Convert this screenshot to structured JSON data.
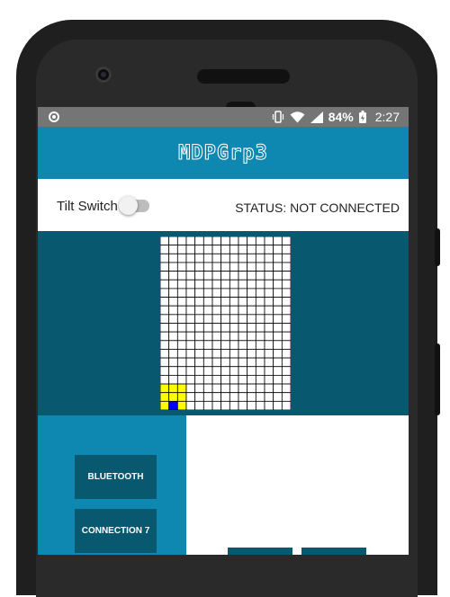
{
  "statusbar": {
    "battery_percent": "84%",
    "time": "2:27",
    "icons": [
      "notification-dot-icon",
      "vibrate-icon",
      "wifi-icon",
      "signal-icon",
      "battery-charging-icon"
    ]
  },
  "appbar": {
    "title": "MDPGrp3"
  },
  "toolbar": {
    "tilt_label": "Tilt Switch",
    "tilt_on": false,
    "status_text": "STATUS: NOT CONNECTED"
  },
  "grid": {
    "cols": 15,
    "rows": 20,
    "highlight_cells": [
      {
        "col": 0,
        "row": 17,
        "color": "#ffff00"
      },
      {
        "col": 1,
        "row": 17,
        "color": "#ffff00"
      },
      {
        "col": 2,
        "row": 17,
        "color": "#ffff00"
      },
      {
        "col": 0,
        "row": 18,
        "color": "#ffff00"
      },
      {
        "col": 1,
        "row": 18,
        "color": "#ffff00"
      },
      {
        "col": 2,
        "row": 18,
        "color": "#ffff00"
      },
      {
        "col": 0,
        "row": 19,
        "color": "#ffff00"
      },
      {
        "col": 1,
        "row": 19,
        "color": "#0000ff"
      },
      {
        "col": 2,
        "row": 19,
        "color": "#ffff00"
      }
    ]
  },
  "buttons": {
    "bluetooth": "BLUETOOTH",
    "connection": "CONNECTION 7"
  },
  "colors": {
    "primary": "#0e87b1",
    "dark": "#085970",
    "robot_body": "#ffff00",
    "robot_head": "#0000ff"
  }
}
